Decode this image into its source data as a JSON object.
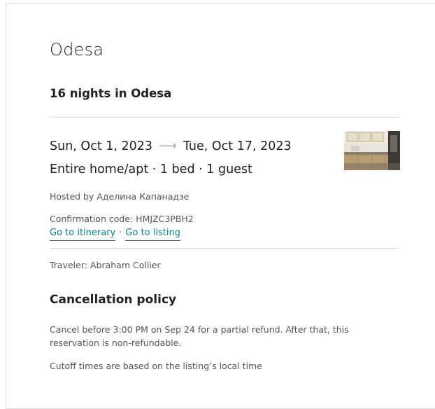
{
  "trip": {
    "city": "Odesa",
    "nights_summary": "16 nights in Odesa"
  },
  "reservation": {
    "check_in": "Sun, Oct 1, 2023",
    "check_out": "Tue, Oct 17, 2023",
    "room_summary": "Entire home/apt · 1 bed · 1 guest",
    "hosted_by": "Hosted by Аделина Капанадзе",
    "confirmation": "Confirmation code: HMJZC3PBH2",
    "listing_photo": "kitchen-interior-photo"
  },
  "links": {
    "itinerary": "Go to itinerary",
    "separator": "·",
    "listing": "Go to listing"
  },
  "traveler": "Traveler: Abraham Collier",
  "cancellation": {
    "title": "Cancellation policy",
    "text": "Cancel before 3:00 PM on Sep 24 for a partial refund. After that, this reservation is non-refundable.",
    "cutoff": "Cutoff times are based on the listing’s local time"
  },
  "icons": {
    "arrow": "arrow-right-icon"
  },
  "colors": {
    "link": "#008489",
    "divider": "#dddddd",
    "text_primary": "#222222",
    "text_secondary": "#555555"
  }
}
